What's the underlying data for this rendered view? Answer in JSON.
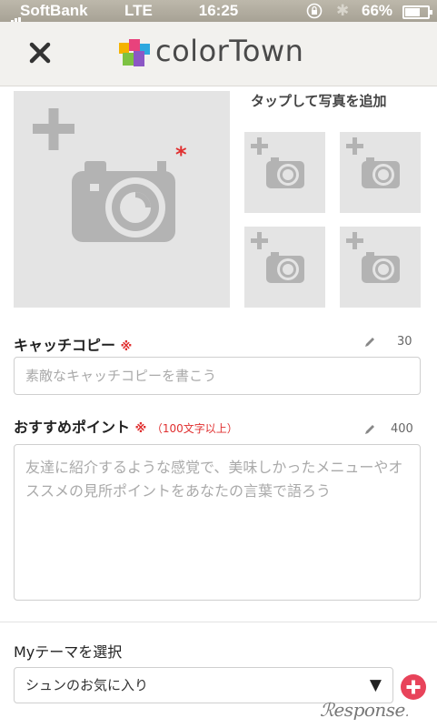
{
  "status_bar": {
    "carrier": "SoftBank",
    "network": "LTE",
    "time": "16:25",
    "battery_percent": "66%"
  },
  "header": {
    "close_icon": "close-icon",
    "logo_text": "colorTown",
    "logo_colors": [
      "#f4b300",
      "#e8427c",
      "#2ea8df",
      "#7dc242",
      "#8b57c5"
    ]
  },
  "photos": {
    "hint": "タップして写真を追加",
    "main_required_mark": "*",
    "icon": "camera-plus-icon",
    "thumb_count": 4
  },
  "catch_copy": {
    "label": "キャッチコピー",
    "required_mark": "※",
    "max_chars": "30",
    "placeholder": "素敵なキャッチコピーを書こう"
  },
  "recommend_point": {
    "label": "おすすめポイント",
    "required_mark": "※",
    "required_note": "（100文字以上）",
    "max_chars": "400",
    "placeholder": "友達に紹介するような感覚で、美味しかったメニューやオススメの見所ポイントをあなたの言葉で語ろう"
  },
  "my_theme": {
    "label": "Myテーマを選択",
    "selected": "シュンのお気に入り",
    "arrow": "▼"
  },
  "watermark": {
    "text": "esponse",
    "dot": "."
  },
  "colors": {
    "accent_red": "#e03030",
    "placeholder_gray": "#aaaaaa",
    "photo_bg": "#e4e4e4",
    "header_bg": "#f2f1ee"
  }
}
